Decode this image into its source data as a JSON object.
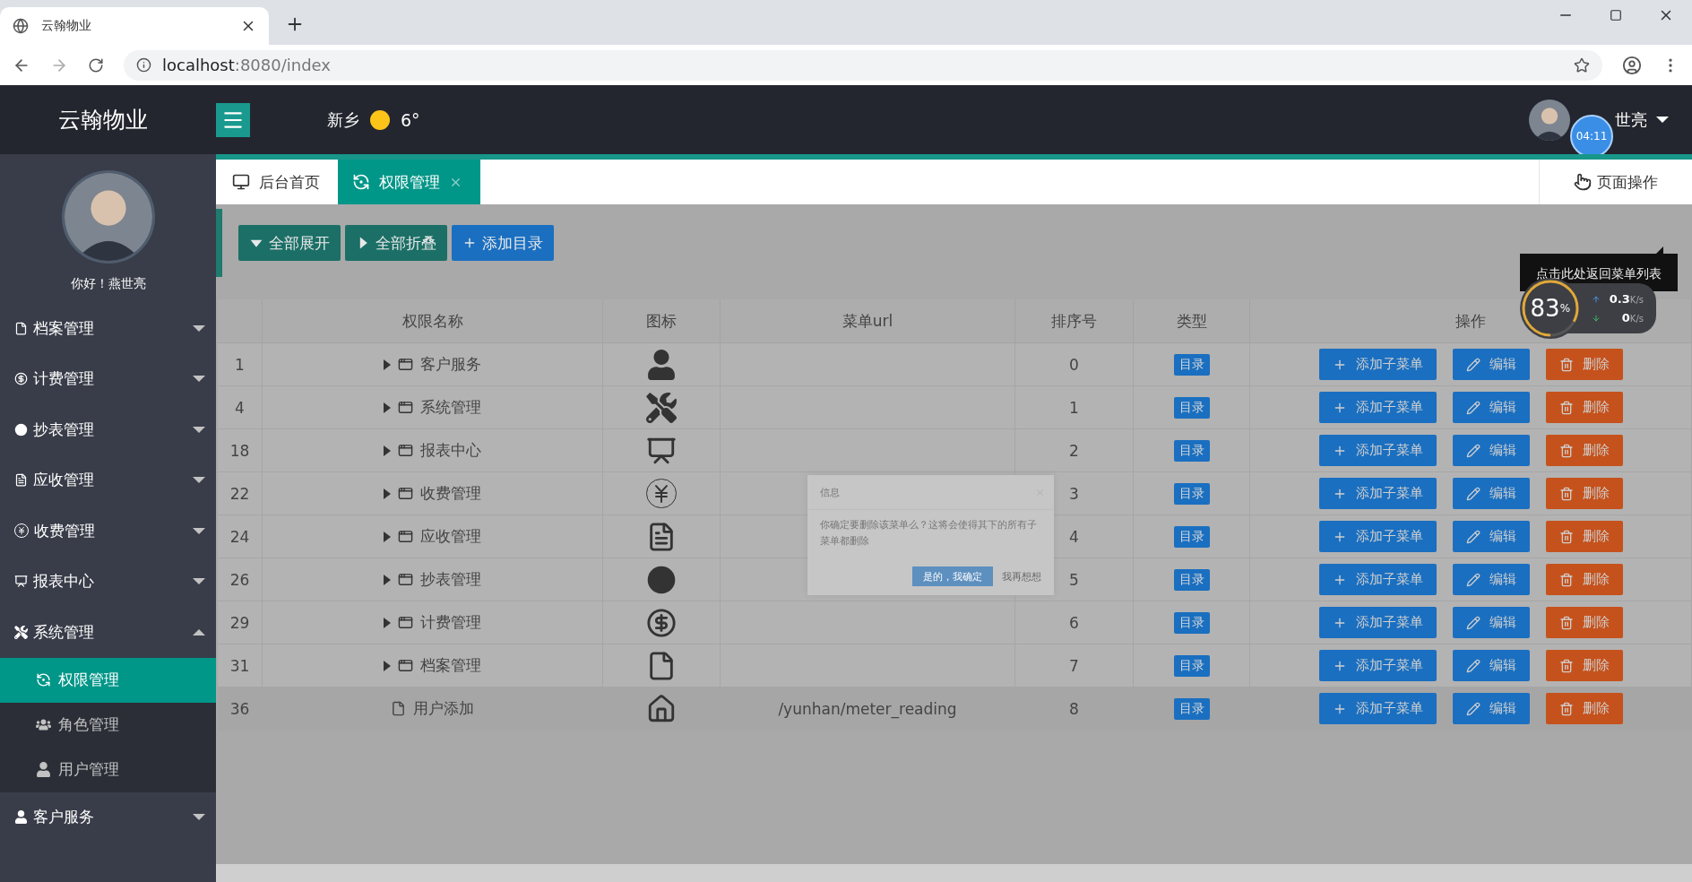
{
  "browser": {
    "tab_title": "云翰物业",
    "url_host": "localhost",
    "url_path": ":8080/index"
  },
  "header": {
    "logo": "云翰物业",
    "city": "新乡",
    "temperature": "6°",
    "user_name": "世亮",
    "timer": "04:11"
  },
  "sidebar": {
    "greeting": "你好！燕世亮",
    "items": [
      {
        "label": "档案管理",
        "kind": "file",
        "expanded": false
      },
      {
        "label": "计费管理",
        "kind": "dollar",
        "expanded": false
      },
      {
        "label": "抄表管理",
        "kind": "disc",
        "expanded": false
      },
      {
        "label": "应收管理",
        "kind": "question",
        "expanded": false
      },
      {
        "label": "收费管理",
        "kind": "yen",
        "expanded": false
      },
      {
        "label": "报表中心",
        "kind": "chart",
        "expanded": false
      },
      {
        "label": "系统管理",
        "kind": "tools",
        "expanded": true,
        "children": [
          {
            "label": "权限管理",
            "kind": "refresh",
            "selected": true
          },
          {
            "label": "角色管理",
            "kind": "users",
            "selected": false
          },
          {
            "label": "用户管理",
            "kind": "person",
            "selected": false
          }
        ]
      },
      {
        "label": "客户服务",
        "kind": "person",
        "expanded": false
      }
    ]
  },
  "tabs": [
    {
      "label": "后台首页",
      "kind": "monitor",
      "selected": false,
      "closable": false
    },
    {
      "label": "权限管理",
      "kind": "refresh",
      "selected": true,
      "closable": true
    }
  ],
  "page_actions": "页面操作",
  "toolbar": [
    {
      "label": "全部展开",
      "kind": "expand"
    },
    {
      "label": "全部折叠",
      "kind": "collapse"
    },
    {
      "label": "添加目录",
      "kind": "add"
    }
  ],
  "table": {
    "columns": [
      "权限名称",
      "图标",
      "菜单url",
      "排序号",
      "类型",
      "操作"
    ],
    "rows": [
      {
        "index": "1",
        "name": "客户服务",
        "kind": "person",
        "order": "0",
        "type": "目录",
        "expandable": true,
        "highlighted": false,
        "actions": [
          {
            "label": "添加子菜单",
            "kind": "add"
          },
          {
            "label": "编辑",
            "kind": "edit"
          },
          {
            "label": "删除",
            "kind": "delete"
          }
        ]
      },
      {
        "index": "4",
        "name": "系统管理",
        "kind": "tools",
        "order": "1",
        "type": "目录",
        "expandable": true,
        "highlighted": false,
        "actions": [
          {
            "label": "添加子菜单",
            "kind": "add"
          },
          {
            "label": "编辑",
            "kind": "edit"
          },
          {
            "label": "删除",
            "kind": "delete"
          }
        ]
      },
      {
        "index": "18",
        "name": "报表中心",
        "kind": "chart",
        "order": "2",
        "type": "目录",
        "expandable": true,
        "highlighted": false,
        "actions": [
          {
            "label": "添加子菜单",
            "kind": "add"
          },
          {
            "label": "编辑",
            "kind": "edit"
          },
          {
            "label": "删除",
            "kind": "delete"
          }
        ]
      },
      {
        "index": "22",
        "name": "收费管理",
        "kind": "yen",
        "order": "3",
        "type": "目录",
        "expandable": true,
        "highlighted": false,
        "actions": [
          {
            "label": "添加子菜单",
            "kind": "add"
          },
          {
            "label": "编辑",
            "kind": "edit"
          },
          {
            "label": "删除",
            "kind": "delete"
          }
        ]
      },
      {
        "index": "24",
        "name": "应收管理",
        "kind": "question",
        "order": "4",
        "type": "目录",
        "expandable": true,
        "highlighted": false,
        "actions": [
          {
            "label": "添加子菜单",
            "kind": "add"
          },
          {
            "label": "编辑",
            "kind": "edit"
          },
          {
            "label": "删除",
            "kind": "delete"
          }
        ]
      },
      {
        "index": "26",
        "name": "抄表管理",
        "kind": "disc",
        "order": "5",
        "type": "目录",
        "expandable": true,
        "highlighted": false,
        "actions": [
          {
            "label": "添加子菜单",
            "kind": "add"
          },
          {
            "label": "编辑",
            "kind": "edit"
          },
          {
            "label": "删除",
            "kind": "delete"
          }
        ]
      },
      {
        "index": "29",
        "name": "计费管理",
        "kind": "dollar",
        "order": "6",
        "type": "目录",
        "expandable": true,
        "highlighted": false,
        "actions": [
          {
            "label": "添加子菜单",
            "kind": "add"
          },
          {
            "label": "编辑",
            "kind": "edit"
          },
          {
            "label": "删除",
            "kind": "delete"
          }
        ]
      },
      {
        "index": "31",
        "name": "档案管理",
        "kind": "file",
        "order": "7",
        "type": "目录",
        "expandable": true,
        "highlighted": false,
        "actions": [
          {
            "label": "添加子菜单",
            "kind": "add"
          },
          {
            "label": "编辑",
            "kind": "edit"
          },
          {
            "label": "删除",
            "kind": "delete"
          }
        ]
      },
      {
        "index": "36",
        "name": "用户添加",
        "kind": "house",
        "url": "/yunhan/meter_reading",
        "order": "8",
        "type": "目录",
        "expandable": false,
        "highlighted": true,
        "actions": [
          {
            "label": "添加子菜单",
            "kind": "add"
          },
          {
            "label": "编辑",
            "kind": "edit"
          },
          {
            "label": "删除",
            "kind": "delete"
          }
        ]
      }
    ]
  },
  "dialog": {
    "title": "信息",
    "message": "你确定要删除该菜单么？这将会使得其下的所有子菜单都删除",
    "confirm": "是的，我确定",
    "cancel": "我再想想"
  },
  "tooltip": "点击此处返回菜单列表",
  "network_widget": {
    "percent": "83",
    "unit": "%",
    "level": 0.83,
    "upload": "0.3",
    "upload_unit": "K/s",
    "download": "0",
    "download_unit": "K/s"
  }
}
